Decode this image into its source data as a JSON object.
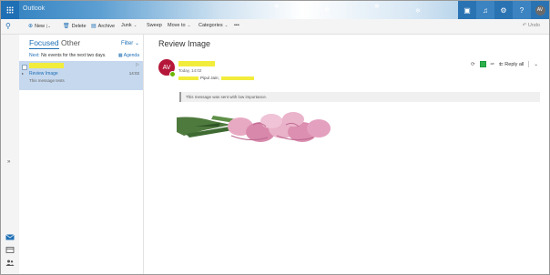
{
  "header": {
    "app_title": "Outlook",
    "icons": [
      "skype-icon",
      "bell-icon",
      "gear-icon",
      "help-icon"
    ],
    "avatar_initials": "AV",
    "accent": "#1f6fb5"
  },
  "toolbar": {
    "new_label": "New",
    "delete_label": "Delete",
    "archive_label": "Archive",
    "junk_label": "Junk",
    "sweep_label": "Sweep",
    "move_to_label": "Move to",
    "categories_label": "Categories",
    "more_label": "•••",
    "undo_label": "Undo"
  },
  "list": {
    "tab_focused": "Focused",
    "tab_other": "Other",
    "filter_label": "Filter",
    "next_label": "Next:",
    "next_text": "No events for the next two days.",
    "agenda_label": "Agenda",
    "messages": [
      {
        "subject": "Review Image",
        "time": "14:02",
        "preview": "This message tests"
      }
    ]
  },
  "reading": {
    "title": "Review Image",
    "avatar_initials": "AV",
    "date": "Today, 14:02",
    "to_label": "Pipul Jain;",
    "reply_all_label": "Reply all",
    "importance_note": "This message was sent with low importance."
  },
  "colors": {
    "selected_row": "#c5d8ee",
    "avatar": "#b5173a",
    "redaction": "#f2ec3c"
  }
}
